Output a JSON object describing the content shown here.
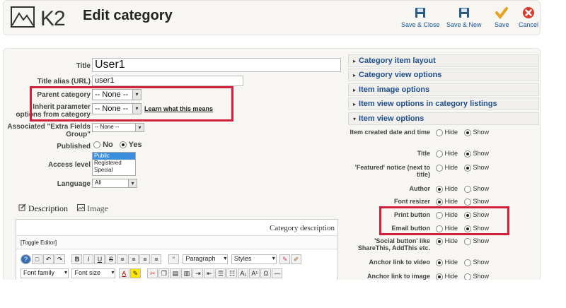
{
  "header": {
    "logo_text": "K2",
    "title": "Edit category",
    "toolbar": [
      {
        "label": "Save & Close",
        "icon": "save-icon"
      },
      {
        "label": "Save & New",
        "icon": "save-icon"
      },
      {
        "label": "Save",
        "icon": "check-icon"
      },
      {
        "label": "Cancel",
        "icon": "cancel-icon"
      }
    ]
  },
  "form": {
    "title_label": "Title",
    "title_value": "User1",
    "alias_label": "Title alias (URL)",
    "alias_value": "user1",
    "parent_label": "Parent category",
    "parent_value": "-- None --",
    "inherit_label": "Inherit parameter options from category",
    "inherit_value": "-- None --",
    "inherit_link": "Learn what this means",
    "extra_fields_label": "Associated \"Extra Fields Group\"",
    "extra_fields_value": "-- None --",
    "published_label": "Published",
    "published_no": "No",
    "published_yes": "Yes",
    "access_label": "Access level",
    "access_options": [
      "Public",
      "Registered",
      "Special"
    ],
    "language_label": "Language",
    "language_value": "All"
  },
  "editor": {
    "tab_description": "Description",
    "tab_image": "Image",
    "field_label": "Category description",
    "toggle": "[Toggle Editor]",
    "format_value": "Paragraph",
    "styles_value": "Styles",
    "font_family": "Font family",
    "font_size": "Font size"
  },
  "right": {
    "sections": [
      "Category item layout",
      "Category view options",
      "Item image options",
      "Item view options in category listings",
      "Item view options"
    ],
    "hide": "Hide",
    "show": "Show",
    "options": [
      {
        "label": "Item created date and time",
        "value": "show"
      },
      {
        "label": "Title",
        "value": "show"
      },
      {
        "label": "'Featured' notice (next to title)",
        "value": "show"
      },
      {
        "label": "Author",
        "value": "hide"
      },
      {
        "label": "Font resizer",
        "value": "hide"
      },
      {
        "label": "Print button",
        "value": "show"
      },
      {
        "label": "Email button",
        "value": "show"
      },
      {
        "label": "'Social button' like ShareThis, AddThis etc.",
        "value": "hide"
      },
      {
        "label": "Anchor link to video",
        "value": "hide"
      },
      {
        "label": "Anchor link to image",
        "value": "hide"
      }
    ]
  },
  "colors": {
    "accent": "#1f4f8f",
    "highlight": "#d0203a"
  }
}
